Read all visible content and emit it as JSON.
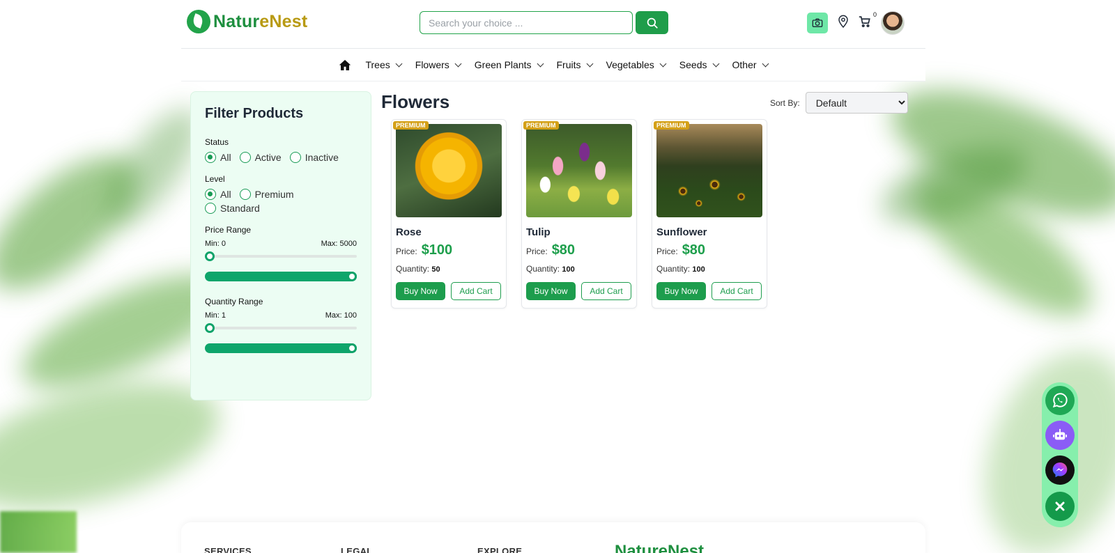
{
  "brand": {
    "name_part1": "Natur",
    "name_part2": "eNest"
  },
  "search": {
    "placeholder": "Search your choice ..."
  },
  "header": {
    "cart_count": "0"
  },
  "nav": {
    "items": [
      {
        "label": "Trees"
      },
      {
        "label": "Flowers"
      },
      {
        "label": "Green Plants"
      },
      {
        "label": "Fruits"
      },
      {
        "label": "Vegetables"
      },
      {
        "label": "Seeds"
      },
      {
        "label": "Other"
      }
    ]
  },
  "filter": {
    "title": "Filter Products",
    "status": {
      "label": "Status",
      "options": [
        "All",
        "Active",
        "Inactive"
      ],
      "selected": "All"
    },
    "level": {
      "label": "Level",
      "options": [
        "All",
        "Premium",
        "Standard"
      ],
      "selected": "All"
    },
    "price": {
      "label": "Price Range",
      "min_label": "Min: 0",
      "max_label": "Max: 5000"
    },
    "quantity": {
      "label": "Quantity Range",
      "min_label": "Min: 1",
      "max_label": "Max: 100"
    }
  },
  "main": {
    "title": "Flowers",
    "sort_label": "Sort By:",
    "sort_value": "Default"
  },
  "products": [
    {
      "badge": "PREMIUM",
      "name": "Rose",
      "price_label": "Price:",
      "price": "$100",
      "qty_label": "Quantity:",
      "qty": "50",
      "buy": "Buy Now",
      "add": "Add Cart"
    },
    {
      "badge": "PREMIUM",
      "name": "Tulip",
      "price_label": "Price:",
      "price": "$80",
      "qty_label": "Quantity:",
      "qty": "100",
      "buy": "Buy Now",
      "add": "Add Cart"
    },
    {
      "badge": "PREMIUM",
      "name": "Sunflower",
      "price_label": "Price:",
      "price": "$80",
      "qty_label": "Quantity:",
      "qty": "100",
      "buy": "Buy Now",
      "add": "Add Cart"
    }
  ],
  "footer": {
    "col1": "SERVICES",
    "col2": "LEGAL",
    "col3": "EXPLORE",
    "logo": "NatureNest"
  },
  "colors": {
    "primary": "#1d9d4d",
    "accent_gold": "#b89a13",
    "badge": "#d4a017",
    "panel_bg": "#ecfdf3"
  },
  "icons": [
    "home-icon",
    "search-icon",
    "camera-icon",
    "location-icon",
    "cart-icon",
    "whatsapp-icon",
    "robot-icon",
    "messenger-icon",
    "close-icon"
  ]
}
